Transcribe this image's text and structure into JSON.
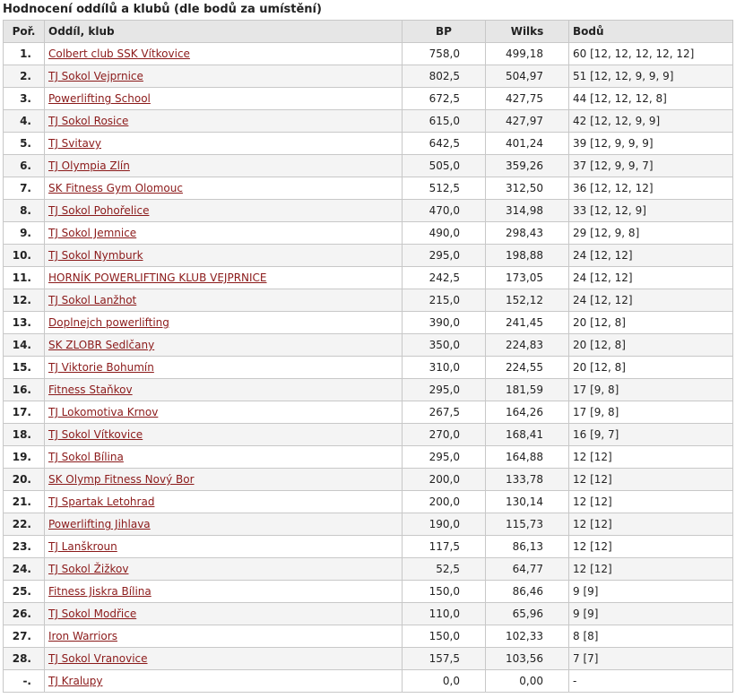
{
  "title": "Hodnocení oddílů a klubů (dle bodů za umístění)",
  "columns": {
    "rank": "Poř.",
    "club": "Oddíl, klub",
    "bp": "BP",
    "wilks": "Wilks",
    "points": "Bodů"
  },
  "colors": {
    "link": "#8b1a1a",
    "header_bg": "#e6e6e6",
    "border": "#c8c8c8"
  },
  "rows": [
    {
      "rank": "1.",
      "club": "Colbert club SSK Vítkovice",
      "bp": "758,0",
      "wilks": "499,18",
      "points": "60 [12, 12, 12, 12, 12]"
    },
    {
      "rank": "2.",
      "club": "TJ Sokol Vejprnice",
      "bp": "802,5",
      "wilks": "504,97",
      "points": "51 [12, 12, 9, 9, 9]"
    },
    {
      "rank": "3.",
      "club": "Powerlifting School",
      "bp": "672,5",
      "wilks": "427,75",
      "points": "44 [12, 12, 12, 8]"
    },
    {
      "rank": "4.",
      "club": "TJ Sokol Rosice",
      "bp": "615,0",
      "wilks": "427,97",
      "points": "42 [12, 12, 9, 9]"
    },
    {
      "rank": "5.",
      "club": "TJ Svitavy",
      "bp": "642,5",
      "wilks": "401,24",
      "points": "39 [12, 9, 9, 9]"
    },
    {
      "rank": "6.",
      "club": "TJ Olympia Zlín",
      "bp": "505,0",
      "wilks": "359,26",
      "points": "37 [12, 9, 9, 7]"
    },
    {
      "rank": "7.",
      "club": "SK Fitness Gym Olomouc",
      "bp": "512,5",
      "wilks": "312,50",
      "points": "36 [12, 12, 12]"
    },
    {
      "rank": "8.",
      "club": "TJ Sokol Pohořelice",
      "bp": "470,0",
      "wilks": "314,98",
      "points": "33 [12, 12, 9]"
    },
    {
      "rank": "9.",
      "club": "TJ Sokol Jemnice",
      "bp": "490,0",
      "wilks": "298,43",
      "points": "29 [12, 9, 8]"
    },
    {
      "rank": "10.",
      "club": "TJ Sokol Nymburk",
      "bp": "295,0",
      "wilks": "198,88",
      "points": "24 [12, 12]"
    },
    {
      "rank": "11.",
      "club": "HORNÍK POWERLIFTING KLUB VEJPRNICE",
      "bp": "242,5",
      "wilks": "173,05",
      "points": "24 [12, 12]"
    },
    {
      "rank": "12.",
      "club": "TJ Sokol Lanžhot",
      "bp": "215,0",
      "wilks": "152,12",
      "points": "24 [12, 12]"
    },
    {
      "rank": "13.",
      "club": "Doplnejch powerlifting",
      "bp": "390,0",
      "wilks": "241,45",
      "points": "20 [12, 8]"
    },
    {
      "rank": "14.",
      "club": "SK ZLOBR Sedlčany",
      "bp": "350,0",
      "wilks": "224,83",
      "points": "20 [12, 8]"
    },
    {
      "rank": "15.",
      "club": "TJ Viktorie Bohumín",
      "bp": "310,0",
      "wilks": "224,55",
      "points": "20 [12, 8]"
    },
    {
      "rank": "16.",
      "club": "Fitness Staňkov",
      "bp": "295,0",
      "wilks": "181,59",
      "points": "17 [9, 8]"
    },
    {
      "rank": "17.",
      "club": "TJ Lokomotiva Krnov",
      "bp": "267,5",
      "wilks": "164,26",
      "points": "17 [9, 8]"
    },
    {
      "rank": "18.",
      "club": "TJ Sokol Vítkovice",
      "bp": "270,0",
      "wilks": "168,41",
      "points": "16 [9, 7]"
    },
    {
      "rank": "19.",
      "club": "TJ Sokol Bílina",
      "bp": "295,0",
      "wilks": "164,88",
      "points": "12 [12]"
    },
    {
      "rank": "20.",
      "club": "SK Olymp Fitness Nový Bor",
      "bp": "200,0",
      "wilks": "133,78",
      "points": "12 [12]"
    },
    {
      "rank": "21.",
      "club": "TJ Spartak Letohrad",
      "bp": "200,0",
      "wilks": "130,14",
      "points": "12 [12]"
    },
    {
      "rank": "22.",
      "club": "Powerlifting Jihlava",
      "bp": "190,0",
      "wilks": "115,73",
      "points": "12 [12]"
    },
    {
      "rank": "23.",
      "club": "TJ Lanškroun",
      "bp": "117,5",
      "wilks": "86,13",
      "points": "12 [12]"
    },
    {
      "rank": "24.",
      "club": "TJ Sokol Žižkov",
      "bp": "52,5",
      "wilks": "64,77",
      "points": "12 [12]"
    },
    {
      "rank": "25.",
      "club": "Fitness Jiskra Bílina",
      "bp": "150,0",
      "wilks": "86,46",
      "points": "9 [9]"
    },
    {
      "rank": "26.",
      "club": "TJ Sokol Modřice",
      "bp": "110,0",
      "wilks": "65,96",
      "points": "9 [9]"
    },
    {
      "rank": "27.",
      "club": "Iron Warriors",
      "bp": "150,0",
      "wilks": "102,33",
      "points": "8 [8]"
    },
    {
      "rank": "28.",
      "club": "TJ Sokol Vranovice",
      "bp": "157,5",
      "wilks": "103,56",
      "points": "7 [7]"
    },
    {
      "rank": "-.",
      "club": "TJ Kralupy",
      "bp": "0,0",
      "wilks": "0,00",
      "points": "-"
    }
  ]
}
